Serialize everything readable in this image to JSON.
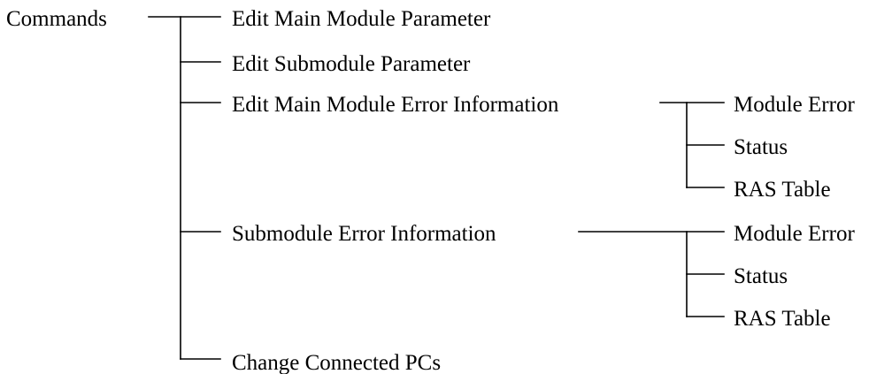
{
  "diagram": {
    "root": "Commands",
    "branches": [
      {
        "label": "Edit Main Module Parameter",
        "children": []
      },
      {
        "label": "Edit Submodule Parameter",
        "children": []
      },
      {
        "label": "Edit Main Module Error Information",
        "children": [
          "Module Error",
          "Status",
          "RAS Table"
        ]
      },
      {
        "label": "Submodule Error Information",
        "children": [
          "Module Error",
          "Status",
          "RAS Table"
        ]
      },
      {
        "label": "Change Connected PCs",
        "children": []
      }
    ]
  }
}
